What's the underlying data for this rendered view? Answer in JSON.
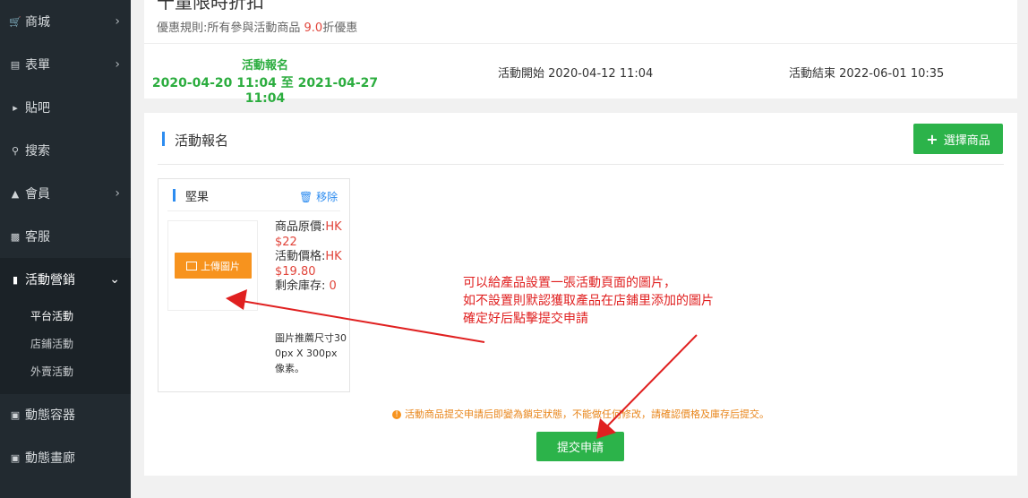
{
  "sidebar": {
    "items": [
      {
        "label": "商城",
        "icon": "cart-icon"
      },
      {
        "label": "表單",
        "icon": "form-icon"
      },
      {
        "label": "貼吧",
        "icon": "megaphone-icon"
      },
      {
        "label": "搜索",
        "icon": "search-icon"
      },
      {
        "label": "會員",
        "icon": "bell-icon"
      },
      {
        "label": "客服",
        "icon": "chat-icon"
      },
      {
        "label": "活動營銷",
        "icon": "bookmark-icon"
      },
      {
        "label": "動態容器",
        "icon": "drive-icon"
      },
      {
        "label": "動態畫廊",
        "icon": "image-icon"
      }
    ],
    "submenu": [
      "平台活動",
      "店鋪活動",
      "外賣活動"
    ]
  },
  "activity": {
    "title_fragment": "十量限時折扣",
    "rule_prefix": "優惠規則:所有參與活動商品",
    "rule_value": "9.0",
    "rule_suffix": "折優惠",
    "status_label": "活動報名",
    "status_range": "2020-04-20 11:04 至 2021-04-27 11:04",
    "start": "活動開始 2020-04-12 11:04",
    "end": "活動結束 2022-06-01 10:35"
  },
  "signup": {
    "section_title": "活動報名",
    "select_button": "選擇商品",
    "product": {
      "name": "堅果",
      "remove": "移除",
      "upload_button": "上傳圖片",
      "price_label": "商品原價:",
      "price_value": "HK$22",
      "activity_price_label": "活動價格:",
      "activity_price_value": "HK$19.80",
      "stock_label": "剩余庫存:",
      "stock_value": "0",
      "image_note": "圖片推薦尺寸300px X 300px像素。"
    },
    "annotation": [
      "可以給產品設置一張活動頁面的圖片，",
      "如不設置則默認獲取產品在店鋪里添加的圖片",
      "確定好后點擊提交申請"
    ],
    "warning": "活動商品提交申請后即變為鎖定狀態，不能做任何修改，請確認價格及庫存后提交。",
    "submit_button": "提交申請"
  },
  "colors": {
    "sidebar_bg": "#222a30",
    "green": "#2cb34a",
    "orange": "#f7931e",
    "red": "#e1453b",
    "blue": "#2d8cf0"
  }
}
